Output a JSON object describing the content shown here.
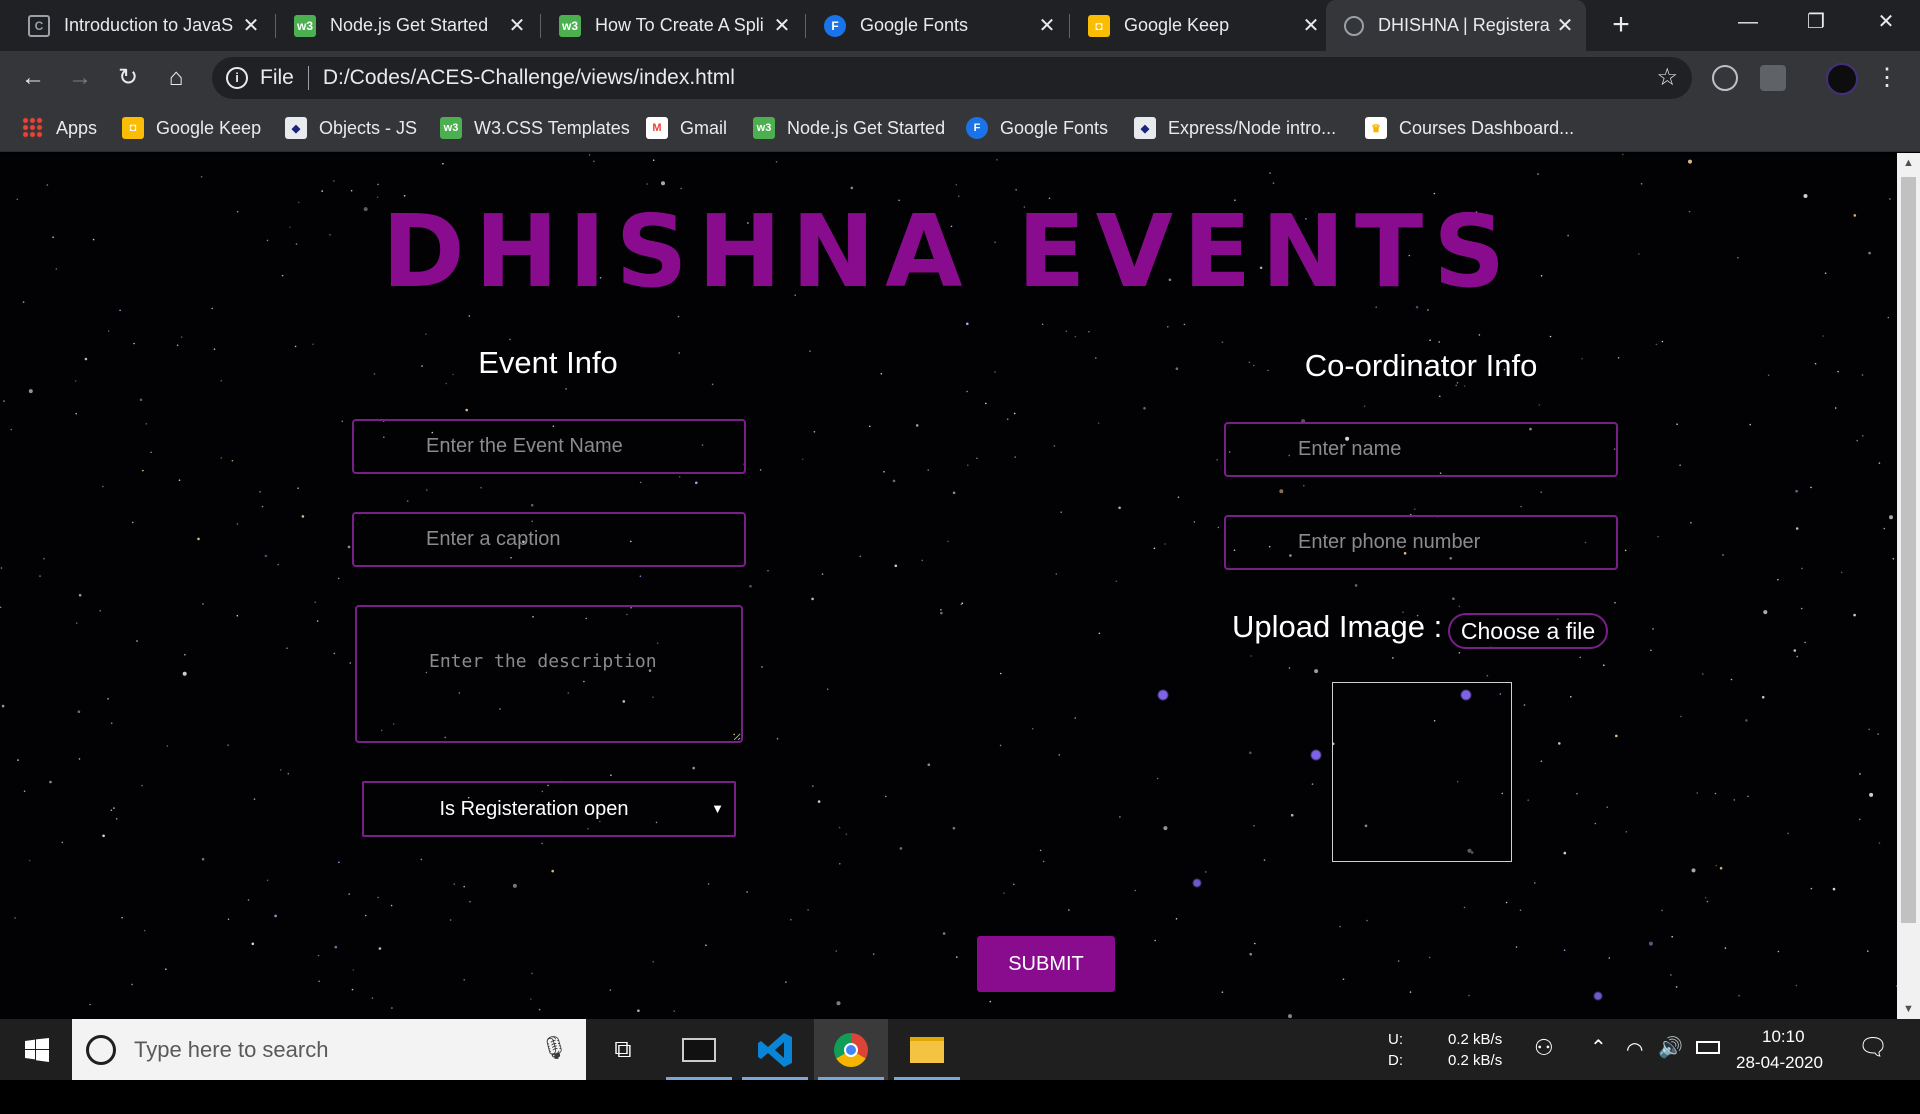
{
  "browser": {
    "tabs": [
      {
        "title": "Introduction to JavaS",
        "icon": "codepen-icon",
        "active": false
      },
      {
        "title": "Node.js Get Started",
        "icon": "w3schools-icon",
        "active": false
      },
      {
        "title": "How To Create A Spli",
        "icon": "w3schools-icon",
        "active": false
      },
      {
        "title": "Google Fonts",
        "icon": "google-fonts-icon",
        "active": false
      },
      {
        "title": "Google Keep",
        "icon": "google-keep-icon",
        "active": false
      },
      {
        "title": "DHISHNA | Registera",
        "icon": "globe-icon",
        "active": true
      }
    ],
    "tab_close_glyph": "✕",
    "new_tab_glyph": "+",
    "url_scheme": "File",
    "url": "D:/Codes/ACES-Challenge/views/index.html",
    "bookmarks": [
      {
        "label": "Apps",
        "icon": "apps-grid-icon"
      },
      {
        "label": "Google Keep",
        "icon": "google-keep-icon"
      },
      {
        "label": "Objects - JS",
        "icon": "bookmark-icon"
      },
      {
        "label": "W3.CSS Templates",
        "icon": "w3schools-icon"
      },
      {
        "label": "Gmail",
        "icon": "gmail-icon"
      },
      {
        "label": "Node.js Get Started",
        "icon": "w3schools-icon"
      },
      {
        "label": "Google Fonts",
        "icon": "google-fonts-icon"
      },
      {
        "label": "Express/Node intro...",
        "icon": "bookmark-icon"
      },
      {
        "label": "Courses Dashboard...",
        "icon": "crown-icon"
      }
    ]
  },
  "page": {
    "heading": "DHISHNA EVENTS",
    "event_section": {
      "title": "Event Info",
      "event_name_placeholder": "Enter the Event Name",
      "caption_placeholder": "Enter a caption",
      "description_placeholder": "Enter the description",
      "registration_select": "Is Registeration open"
    },
    "coordinator_section": {
      "title": "Co-ordinator Info",
      "name_placeholder": "Enter name",
      "phone_placeholder": "Enter phone number",
      "upload_label": "Upload Image :",
      "choose_file_label": "Choose a file"
    },
    "submit_label": "SUBMIT"
  },
  "taskbar": {
    "search_placeholder": "Type here to search",
    "net_up_label": "U:",
    "net_down_label": "D:",
    "net_up_speed": "0.2 kB/s",
    "net_down_speed": "0.2 kB/s",
    "time": "10:10",
    "date": "28-04-2020"
  },
  "colors": {
    "accent": "#8a0c8e",
    "field_border": "#7a1f8a",
    "tab_bar": "#202124",
    "toolbar": "#35363a"
  }
}
